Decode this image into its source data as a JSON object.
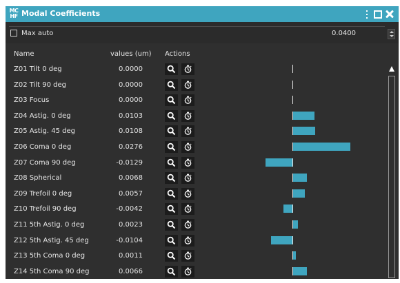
{
  "window": {
    "app_icon": [
      "MC",
      "HF"
    ],
    "title": "Modal Coefficients"
  },
  "controls": {
    "max_auto_label": "Max auto",
    "max_auto_checked": false,
    "max_value": "0.0400"
  },
  "table": {
    "headers": {
      "name": "Name",
      "values": "values (um)",
      "actions": "Actions"
    },
    "rows": [
      {
        "name": "Z01 Tilt 0 deg",
        "value": "0.0000"
      },
      {
        "name": "Z02 Tilt 90 deg",
        "value": "0.0000"
      },
      {
        "name": "Z03 Focus",
        "value": "0.0000"
      },
      {
        "name": "Z04 Astig. 0 deg",
        "value": "0.0103"
      },
      {
        "name": "Z05 Astig. 45 deg",
        "value": "0.0108"
      },
      {
        "name": "Z06 Coma 0 deg",
        "value": "0.0276"
      },
      {
        "name": "Z07 Coma 90 deg",
        "value": "-0.0129"
      },
      {
        "name": "Z08 Spherical",
        "value": "0.0068"
      },
      {
        "name": "Z09 Trefoil 0 deg",
        "value": "0.0057"
      },
      {
        "name": "Z10 Trefoil 90 deg",
        "value": "-0.0042"
      },
      {
        "name": "Z11 5th Astig. 0 deg",
        "value": "0.0023"
      },
      {
        "name": "Z12 5th Astig. 45 deg",
        "value": "-0.0104"
      },
      {
        "name": "Z13 5th Coma 0 deg",
        "value": "0.0011"
      },
      {
        "name": "Z14 5th Coma 90 deg",
        "value": "0.0066"
      }
    ]
  },
  "colors": {
    "accent": "#3fa5bf",
    "background": "#2f2f2f",
    "button_bg": "#1c1c1c"
  },
  "icons": {
    "zoom": "magnifier-icon",
    "clock": "stopwatch-icon"
  }
}
